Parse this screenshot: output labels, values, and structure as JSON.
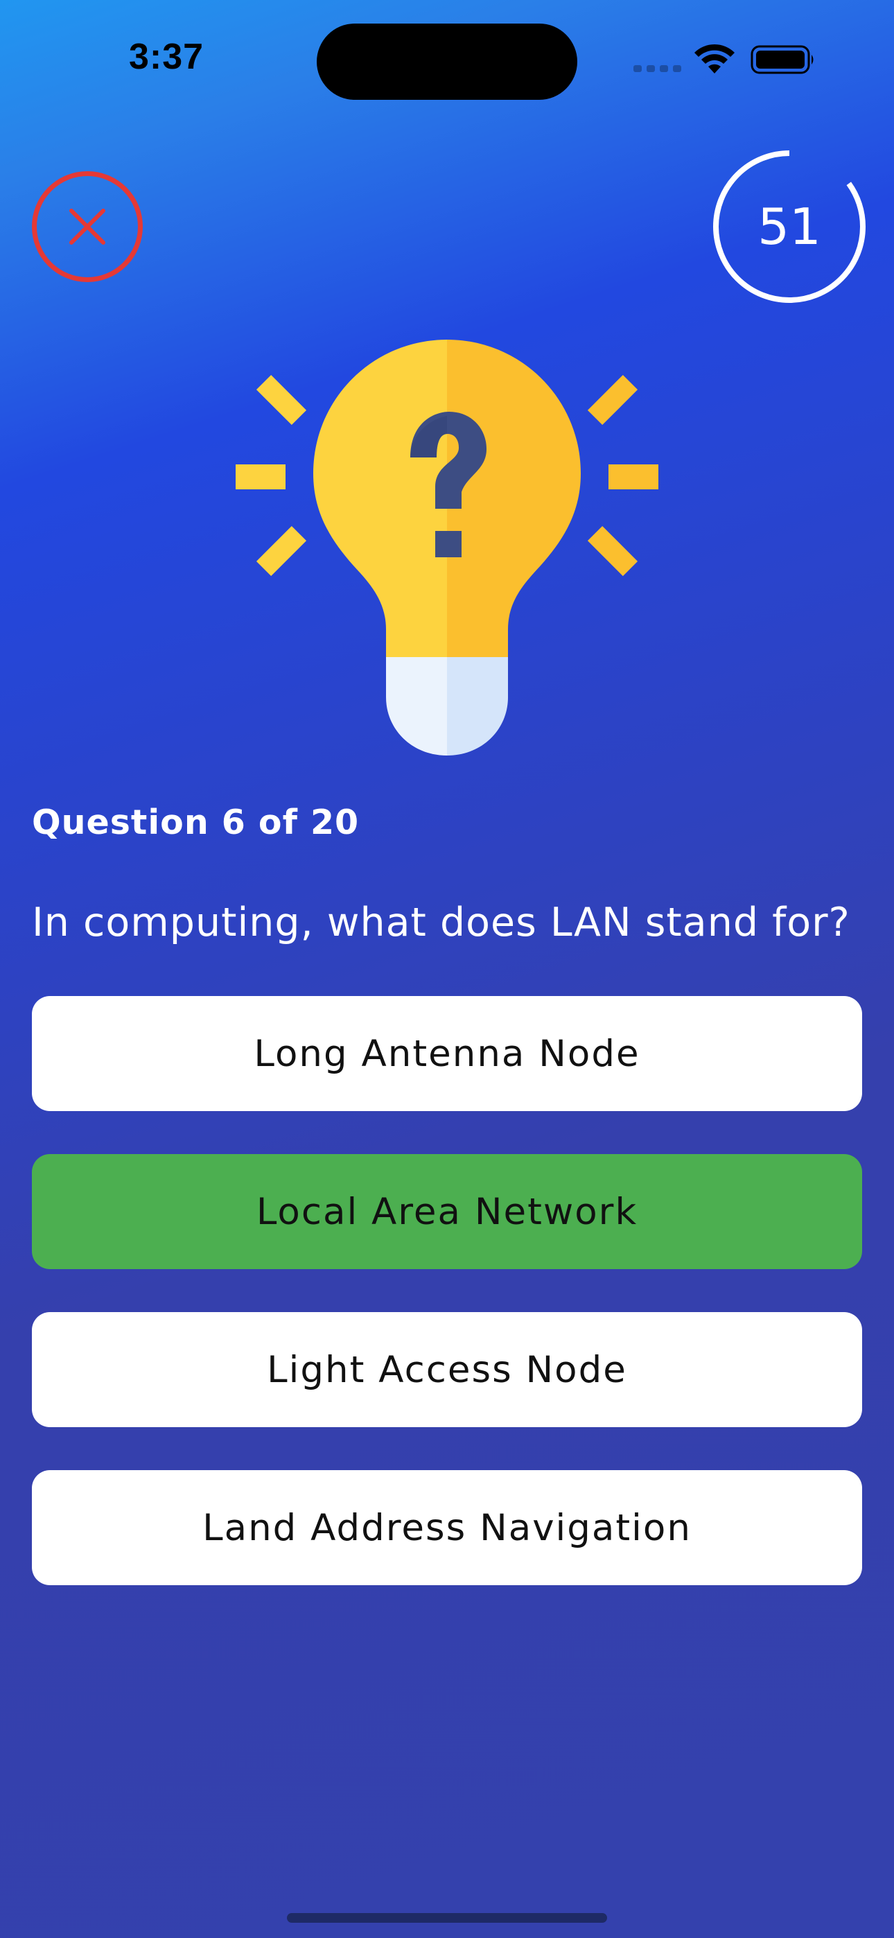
{
  "status_bar": {
    "time": "3:37",
    "icons": [
      "signal-icon",
      "wifi-icon",
      "battery-icon"
    ]
  },
  "header": {
    "close_icon": "close-icon",
    "timer_value": "51",
    "timer_progress": 0.85
  },
  "quiz": {
    "counter": "Question 6 of 20",
    "question": "In computing, what does LAN stand for?",
    "answers": [
      {
        "label": "Long Antenna Node",
        "state": "default"
      },
      {
        "label": "Local Area Network",
        "state": "correct"
      },
      {
        "label": "Light Access Node",
        "state": "default"
      },
      {
        "label": "Land Address Navigation",
        "state": "default"
      }
    ]
  },
  "colors": {
    "close_ring": "#e53935",
    "correct_answer": "#4caf50",
    "bulb_yellow": "#fdd33f",
    "bulb_shade": "#fbbf2e",
    "question_mark": "#3d4d83"
  }
}
